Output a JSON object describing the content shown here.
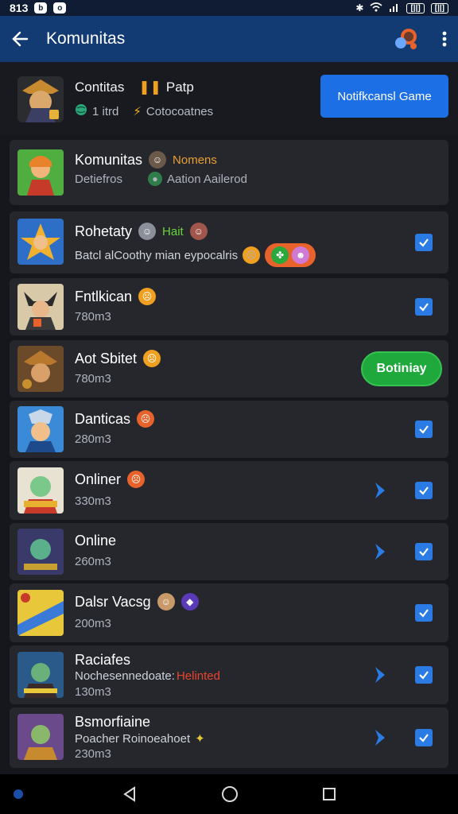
{
  "status": {
    "time": "813",
    "left_icons": [
      "b",
      "o"
    ],
    "battery": "[||]"
  },
  "appbar": {
    "title": "Komunitas",
    "back_icon": "arrow-left-icon",
    "menu_icon": "more-vert-icon"
  },
  "header": {
    "line1_a": "Contitas",
    "line1_b": "Patp",
    "line2_a": "1 itrd",
    "line2_b": "Cotocoatnes",
    "button": "Notifkcansl Game"
  },
  "rows": [
    {
      "name": "Komunitas",
      "tag": "Nomens",
      "sub1": "Detiefros",
      "sub2": "Aation Aailerod"
    },
    {
      "name": "Rohetaty",
      "tag": "Hait",
      "sub": "Batcl alCoothy mian eypocalris"
    },
    {
      "name": "Fntlkican",
      "sub": "780m3"
    },
    {
      "name": "Aot Sbitet",
      "sub": "780m3",
      "button": "Botiniay"
    },
    {
      "name": "Danticas",
      "sub": "280m3"
    },
    {
      "name": "Onliner",
      "sub": "330m3"
    },
    {
      "name": "Online",
      "sub": "260m3"
    },
    {
      "name": "Dalsr Vacsg",
      "sub": "200m3"
    },
    {
      "name": "Raciafes",
      "sub": "Nochesennedoate:",
      "sub_hl": "Helinted",
      "sub2": "130m3"
    },
    {
      "name": "Bsmorfiaine",
      "sub": "Poacher Roinoeahoet",
      "sub2": "230m3"
    }
  ],
  "colors": {
    "appbar": "#123a73",
    "accent": "#1d6fe6",
    "green": "#1fa83c",
    "orange": "#e8632c",
    "highlight": "#e8452c"
  }
}
